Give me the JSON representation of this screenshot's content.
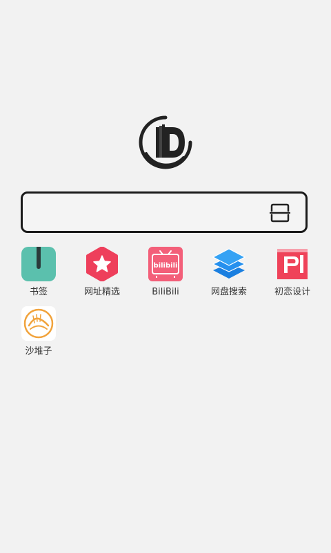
{
  "search": {
    "value": "",
    "placeholder": ""
  },
  "apps": [
    {
      "label": "书签",
      "icon": "bookmark-icon",
      "color": "#5bc0ad"
    },
    {
      "label": "网址精选",
      "icon": "star-hexagon-icon",
      "color": "#ee3f5b"
    },
    {
      "label": "BiliBili",
      "icon": "bilibili-tv-icon",
      "color": "#f35f79",
      "icon_text": "bilibili"
    },
    {
      "label": "网盘搜索",
      "icon": "layers-icon",
      "color": "#1a87e6"
    },
    {
      "label": "初恋设计",
      "icon": "p-letter-icon",
      "color": "#ef4259"
    },
    {
      "label": "沙堆子",
      "icon": "sand-wave-icon",
      "color": "#f1a33c"
    }
  ],
  "colors": {
    "background": "#f2f2f2",
    "border": "#1a1a1a",
    "text": "#333333"
  }
}
